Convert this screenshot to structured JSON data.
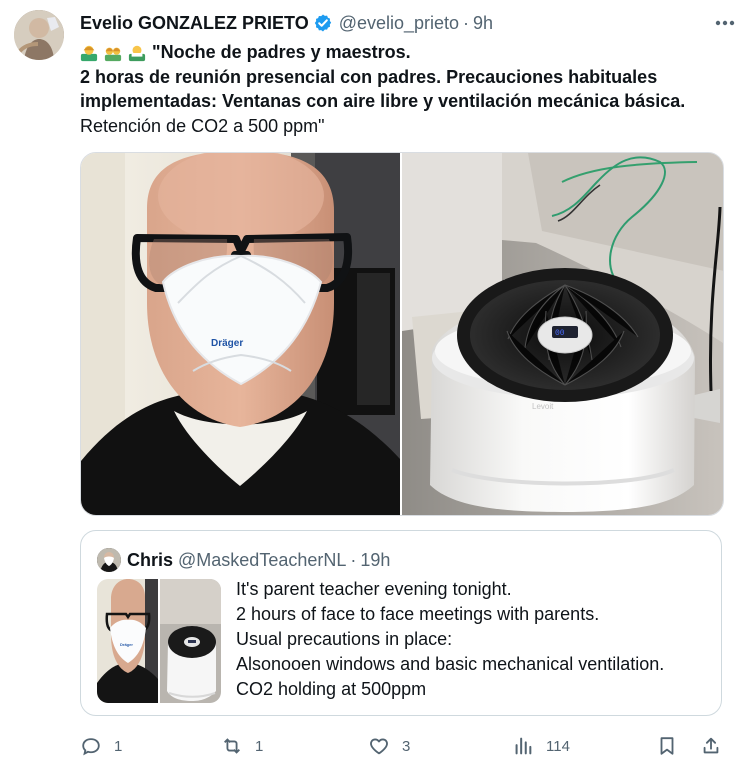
{
  "tweet": {
    "author_name": "Evelio GONZALEZ PRIETO",
    "author_handle": "@evelio_prieto",
    "separator": "·",
    "time": "9h",
    "text_lines": {
      "line1": "\"Noche de padres y maestros.",
      "line2": "2 horas de reunión presencial con padres. Precauciones habituales",
      "line3": "implementadas: Ventanas con aire libre y ventilación mecánica básica.",
      "line4": "Retención de CO2 a 500 ppm\""
    },
    "media": {
      "left_image": "person-wearing-draeger-mask",
      "right_image": "white-air-purifier",
      "mask_brand_text": "Dräger",
      "purifier_brand_text": "Levoit"
    }
  },
  "quoted_tweet": {
    "author_name": "Chris",
    "author_handle": "@MaskedTeacherNL",
    "separator": "·",
    "time": "19h",
    "text_lines": {
      "line1": "It's parent teacher evening tonight.",
      "line2": "2 hours of face to face meetings with parents.",
      "line3": "Usual precautions in place:",
      "line4": "Alsonooen windows and basic mechanical ventilation.",
      "line5": "CO2 holding at 500ppm"
    }
  },
  "actions": {
    "reply_count": "1",
    "retweet_count": "1",
    "like_count": "3",
    "views_count": "114"
  },
  "icons": {
    "verified": "verified-badge-icon",
    "more": "more-horizontal-icon",
    "reply": "reply-icon",
    "retweet": "retweet-icon",
    "like": "heart-icon",
    "views": "views-icon",
    "bookmark": "bookmark-icon",
    "share": "share-icon"
  },
  "colors": {
    "text": "#0f1419",
    "secondary": "#536471",
    "verified": "#1d9bf0",
    "border": "#cfd9de"
  }
}
